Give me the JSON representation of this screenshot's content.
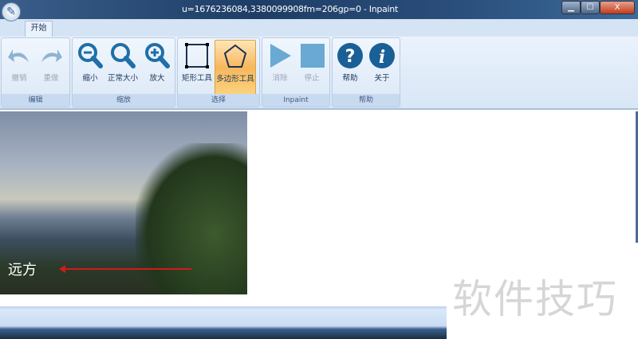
{
  "window": {
    "title": "u=1676236084,3380099908fm=206gp=0        - Inpaint",
    "minimize": "▁",
    "maximize": "☐",
    "close": "X"
  },
  "tabs": [
    {
      "label": "开始"
    }
  ],
  "groups": [
    {
      "label": "编辑",
      "buttons": [
        {
          "label": "撤销",
          "icon": "undo-icon"
        },
        {
          "label": "重做",
          "icon": "redo-icon"
        }
      ]
    },
    {
      "label": "缩放",
      "buttons": [
        {
          "label": "缩小",
          "icon": "zoom-out-icon"
        },
        {
          "label": "正常大小",
          "icon": "zoom-normal-icon"
        },
        {
          "label": "放大",
          "icon": "zoom-in-icon"
        }
      ]
    },
    {
      "label": "选择",
      "buttons": [
        {
          "label": "矩形工具",
          "icon": "rectangle-icon"
        },
        {
          "label": "多边形工具",
          "icon": "polygon-icon"
        }
      ]
    },
    {
      "label": "Inpaint",
      "buttons": [
        {
          "label": "消除",
          "icon": "play-icon"
        },
        {
          "label": "停止",
          "icon": "stop-icon"
        }
      ]
    },
    {
      "label": "帮助",
      "buttons": [
        {
          "label": "帮助",
          "icon": "help-icon"
        },
        {
          "label": "关于",
          "icon": "info-icon"
        }
      ]
    }
  ],
  "image": {
    "logo_text": "远方"
  },
  "watermark": "软件技巧",
  "colors": {
    "accent": "#1f6fa8",
    "active": "#f7b75c"
  }
}
